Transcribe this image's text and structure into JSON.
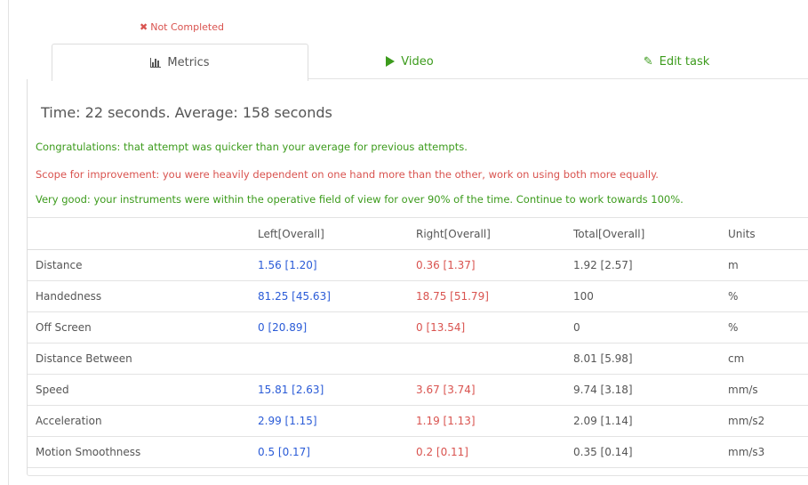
{
  "status": {
    "icon": "x-icon",
    "label": "Not Completed",
    "color": "#d9534f"
  },
  "tabs": [
    {
      "label": "Metrics",
      "icon": "bar-chart-icon",
      "active": true
    },
    {
      "label": "Video",
      "icon": "play-icon",
      "active": false
    },
    {
      "label": "Edit task",
      "icon": "pencil-icon",
      "active": false
    }
  ],
  "summary": {
    "time_text": "Time: 22 seconds. Average: 158 seconds"
  },
  "messages": [
    {
      "text": "Congratulations: that attempt was quicker than your average for previous attempts.",
      "tone": "positive"
    },
    {
      "text": "Scope for improvement: you were heavily dependent on one hand more than the other, work on using both more equally.",
      "tone": "negative"
    },
    {
      "text": "Very good: your instruments were within the operative field of view for over 90% of the time. Continue to work towards 100%.",
      "tone": "positive"
    }
  ],
  "table": {
    "headers": [
      "",
      "Left[Overall]",
      "Right[Overall]",
      "Total[Overall]",
      "Units"
    ],
    "rows": [
      [
        "Distance",
        "1.56 [1.20]",
        "0.36 [1.37]",
        "1.92 [2.57]",
        "m"
      ],
      [
        "Handedness",
        "81.25 [45.63]",
        "18.75 [51.79]",
        "100",
        "%"
      ],
      [
        "Off Screen",
        "0 [20.89]",
        "0 [13.54]",
        "0",
        "%"
      ],
      [
        "Distance Between",
        "",
        "",
        "8.01 [5.98]",
        "cm"
      ],
      [
        "Speed",
        "15.81 [2.63]",
        "3.67 [3.74]",
        "9.74 [3.18]",
        "mm/s"
      ],
      [
        "Acceleration",
        "2.99 [1.15]",
        "1.19 [1.13]",
        "2.09 [1.14]",
        "mm/s2"
      ],
      [
        "Motion Smoothness",
        "0.5 [0.17]",
        "0.2 [0.11]",
        "0.35 [0.14]",
        "mm/s3"
      ]
    ]
  },
  "colors": {
    "positive": "#3c9b1c",
    "negative": "#d9534f",
    "left_hand": "#2a5bd7",
    "right_hand": "#d9534f",
    "text": "#555555"
  }
}
